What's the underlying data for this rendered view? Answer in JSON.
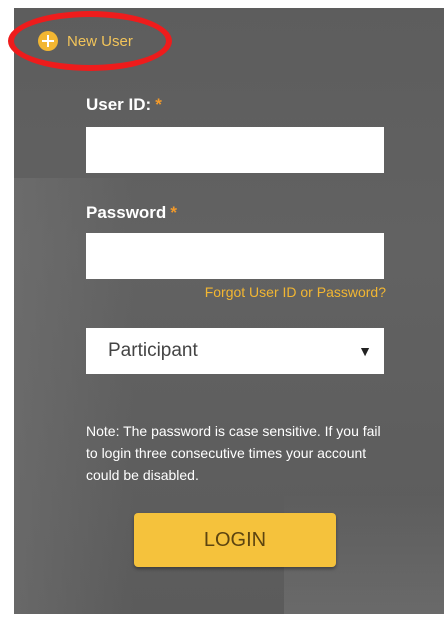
{
  "new_user": {
    "label": "New User",
    "icon": "plus-circle-icon"
  },
  "user_id": {
    "label": "User ID:",
    "required_mark": "*",
    "value": ""
  },
  "password": {
    "label": "Password",
    "required_mark": "*",
    "value": ""
  },
  "forgot_link": "Forgot User ID or Password?",
  "role_select": {
    "selected": "Participant",
    "caret": "▼"
  },
  "note": "Note: The password is case sensitive. If you fail to login three consecutive times your account could be disabled.",
  "login_button": "LOGIN",
  "colors": {
    "accent": "#f2b632",
    "required": "#f39a2a",
    "highlight_annotation": "#ee1c1c",
    "panel_bg": "#5f5f5f"
  }
}
